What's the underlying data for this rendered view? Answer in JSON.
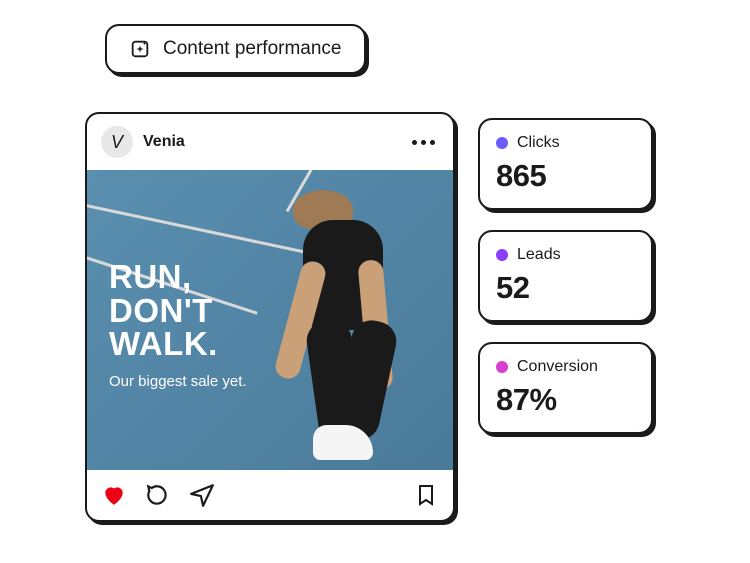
{
  "header": {
    "title": "Content performance"
  },
  "post": {
    "avatar_letter": "V",
    "username": "Venia",
    "headline": "RUN,\nDON'T\nWALK.",
    "subhead": "Our biggest sale yet."
  },
  "metrics": [
    {
      "label": "Clicks",
      "value": "865",
      "dot": "#6b5cff"
    },
    {
      "label": "Leads",
      "value": "52",
      "dot": "#8a3fff"
    },
    {
      "label": "Conversion",
      "value": "87%",
      "dot": "#d83ecf"
    }
  ],
  "icons": {
    "sparkle": "sparkle",
    "more": "more",
    "heart": "heart",
    "comment": "comment",
    "share": "share",
    "bookmark": "bookmark"
  }
}
